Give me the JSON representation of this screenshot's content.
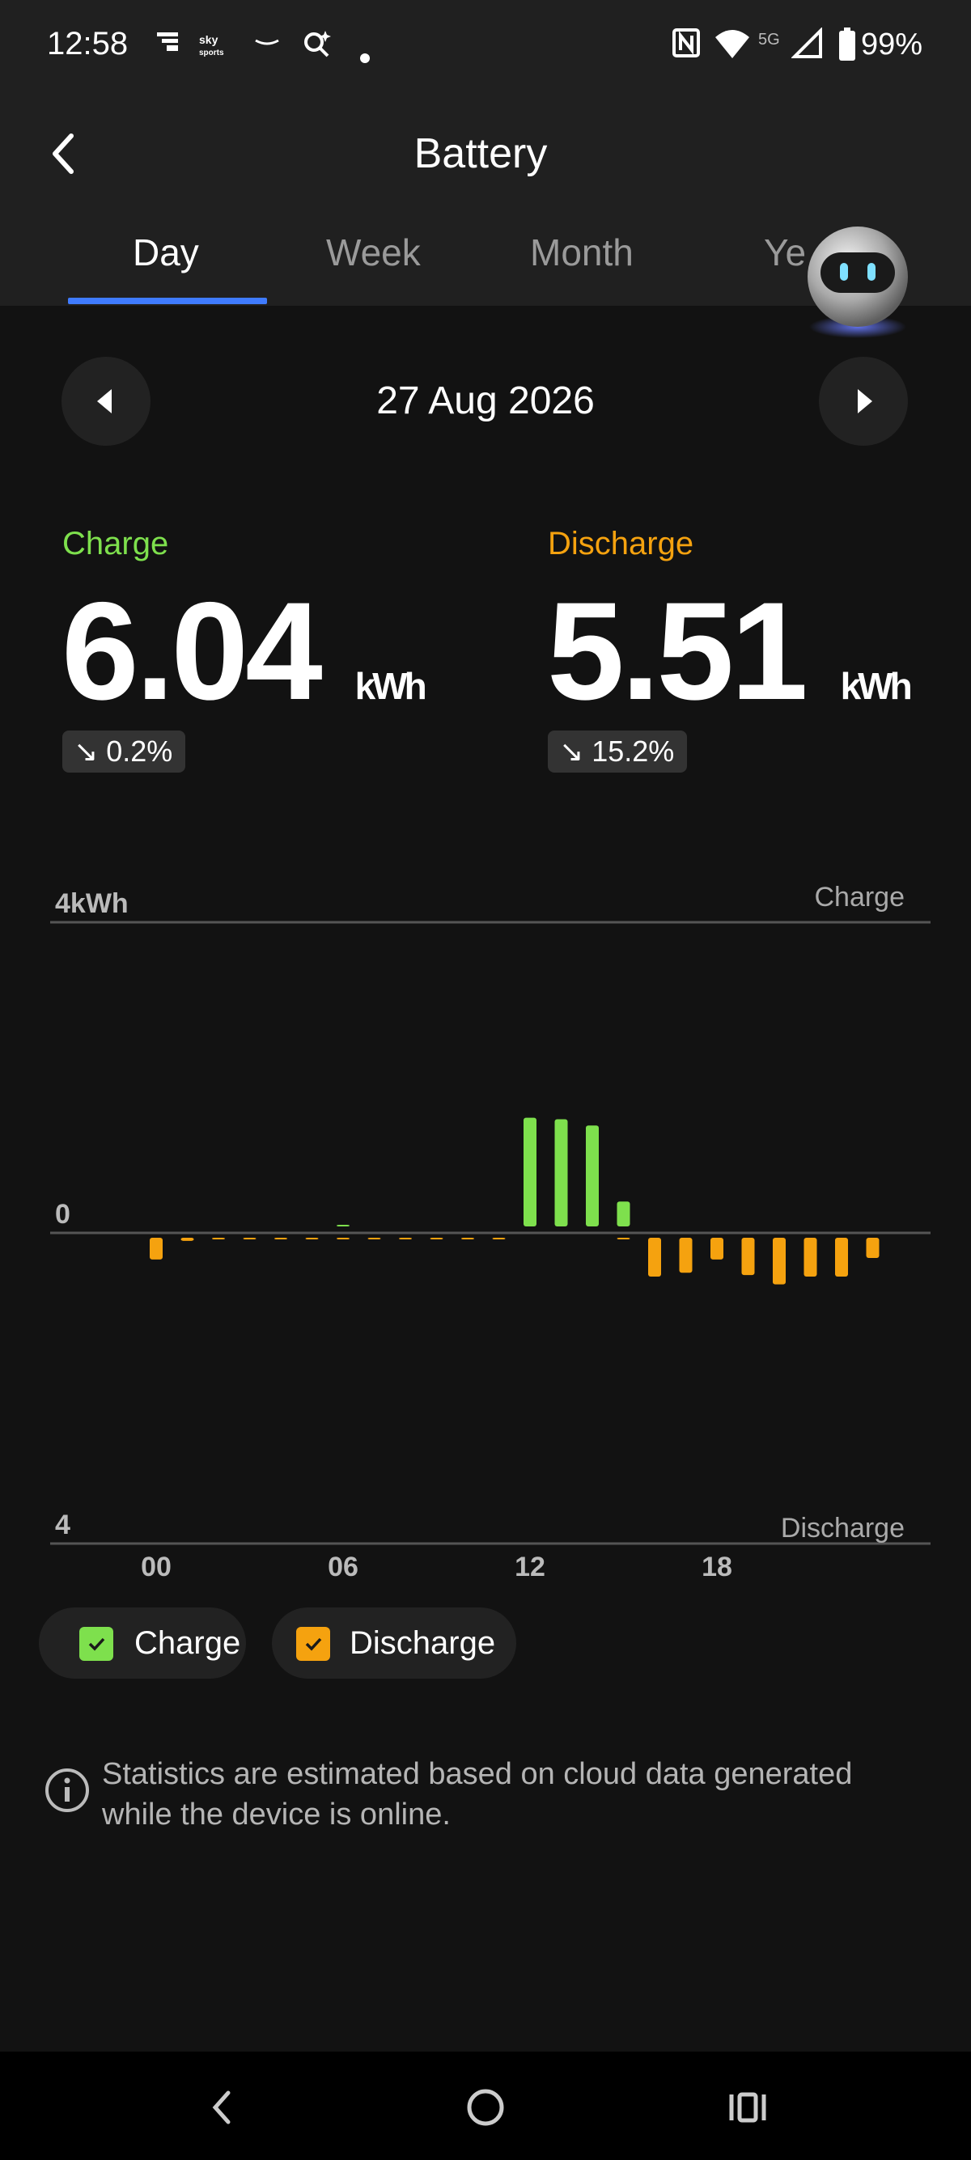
{
  "status_bar": {
    "time": "12:58",
    "battery_percent": "99%",
    "network": "5G",
    "icons": [
      "notification-icon",
      "sky-sports-icon",
      "amazon-icon",
      "search-sparkle-icon",
      "dot-icon",
      "nfc-icon",
      "wifi-icon",
      "signal-icon",
      "battery-icon"
    ]
  },
  "header": {
    "title": "Battery",
    "tabs": [
      {
        "label": "Day",
        "active": true
      },
      {
        "label": "Week",
        "active": false
      },
      {
        "label": "Month",
        "active": false
      },
      {
        "label": "Ye",
        "active": false
      }
    ]
  },
  "date_nav": {
    "date": "27 Aug 2026"
  },
  "summary": {
    "charge": {
      "label": "Charge",
      "value": "6.04",
      "unit": "kWh",
      "change": "0.2%",
      "color": "#7ee04d"
    },
    "discharge": {
      "label": "Discharge",
      "value": "5.51",
      "unit": "kWh",
      "change": "15.2%",
      "color": "#f5a20f"
    }
  },
  "chart_data": {
    "type": "bar",
    "title": "",
    "x_tick_labels": [
      "00",
      "06",
      "12",
      "18"
    ],
    "y_top_label": "4kWh",
    "y_zero_label": "0",
    "y_bottom_label": "4",
    "top_series_label": "Charge",
    "bottom_series_label": "Discharge",
    "ylim": [
      -4,
      4
    ],
    "categories": [
      "00",
      "01",
      "02",
      "03",
      "04",
      "05",
      "06",
      "07",
      "08",
      "09",
      "10",
      "11",
      "12",
      "13",
      "14",
      "15",
      "16",
      "17",
      "18",
      "19",
      "20",
      "21",
      "22",
      "23"
    ],
    "series": [
      {
        "name": "Charge",
        "color": "#7ee04d",
        "values": [
          0,
          0,
          0,
          0,
          0,
          0,
          0.01,
          0,
          0,
          0,
          0,
          0,
          1.4,
          1.38,
          1.3,
          0.32,
          0,
          0,
          0,
          0,
          0,
          0,
          0,
          0
        ]
      },
      {
        "name": "Discharge",
        "color": "#f5a20f",
        "values": [
          0.28,
          0.04,
          0.01,
          0.01,
          0.01,
          0.01,
          0.01,
          0.01,
          0.01,
          0.01,
          0.01,
          0.01,
          0,
          0,
          0,
          0.02,
          0.5,
          0.45,
          0.28,
          0.48,
          0.6,
          0.5,
          0.5,
          0.26
        ]
      }
    ],
    "legend": [
      {
        "label": "Charge",
        "color": "#7ee04d",
        "checked": true
      },
      {
        "label": "Discharge",
        "color": "#f5a20f",
        "checked": true
      }
    ]
  },
  "info": {
    "text": "Statistics are estimated based on cloud data generated while the device is online."
  },
  "navbar": {
    "icons": [
      "back-nav-icon",
      "home-nav-icon",
      "recents-nav-icon"
    ]
  }
}
